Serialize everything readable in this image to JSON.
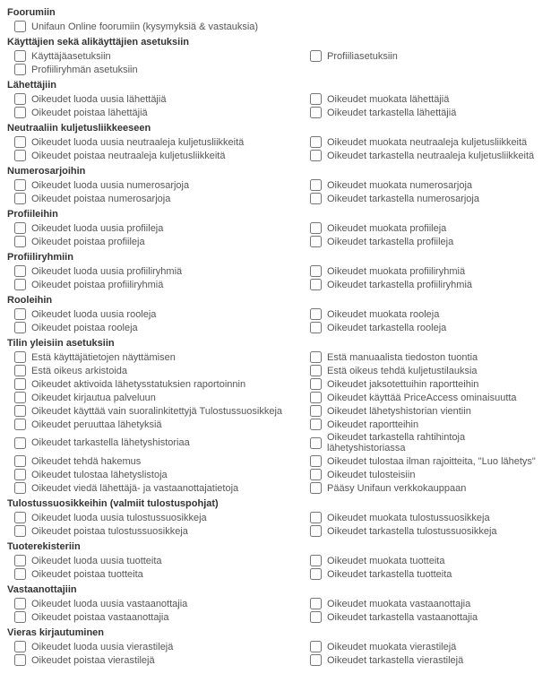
{
  "sections": [
    {
      "title": "Foorumiin",
      "items": [
        {
          "label": "Unifaun Online foorumiin (kysymyksiä & vastauksia)",
          "full": true
        }
      ]
    },
    {
      "title": "Käyttäjien sekä alikäyttäjien asetuksiin",
      "items": [
        {
          "label": "Käyttäjäasetuksiin"
        },
        {
          "label": "Profiiliasetuksiin"
        },
        {
          "label": "Profiiliryhmän asetuksiin",
          "full": true
        }
      ]
    },
    {
      "title": "Lähettäjiin",
      "items": [
        {
          "label": "Oikeudet luoda uusia lähettäjiä"
        },
        {
          "label": "Oikeudet muokata lähettäjiä"
        },
        {
          "label": "Oikeudet poistaa lähettäjiä"
        },
        {
          "label": "Oikeudet tarkastella lähettäjiä"
        }
      ]
    },
    {
      "title": "Neutraaliin kuljetusliikkeeseen",
      "items": [
        {
          "label": "Oikeudet luoda uusia neutraaleja kuljetusliikkeitä"
        },
        {
          "label": "Oikeudet muokata neutraaleja kuljetusliikkeitä"
        },
        {
          "label": "Oikeudet poistaa neutraaleja kuljetusliikkeitä"
        },
        {
          "label": "Oikeudet tarkastella neutraaleja kuljetusliikkeitä"
        }
      ]
    },
    {
      "title": "Numerosarjoihin",
      "items": [
        {
          "label": "Oikeudet luoda uusia numerosarjoja"
        },
        {
          "label": "Oikeudet muokata numerosarjoja"
        },
        {
          "label": "Oikeudet poistaa numerosarjoja"
        },
        {
          "label": "Oikeudet tarkastella numerosarjoja"
        }
      ]
    },
    {
      "title": "Profiileihin",
      "items": [
        {
          "label": "Oikeudet luoda uusia profiileja"
        },
        {
          "label": "Oikeudet muokata profiileja"
        },
        {
          "label": "Oikeudet poistaa profiileja"
        },
        {
          "label": "Oikeudet tarkastella profiileja"
        }
      ]
    },
    {
      "title": "Profiiliryhmiin",
      "items": [
        {
          "label": "Oikeudet luoda uusia profiiliryhmiä"
        },
        {
          "label": "Oikeudet muokata profiiliryhmiä"
        },
        {
          "label": "Oikeudet poistaa profiiliryhmiä"
        },
        {
          "label": "Oikeudet tarkastella profiiliryhmiä"
        }
      ]
    },
    {
      "title": "Rooleihin",
      "items": [
        {
          "label": "Oikeudet luoda uusia rooleja"
        },
        {
          "label": "Oikeudet muokata rooleja"
        },
        {
          "label": "Oikeudet poistaa rooleja"
        },
        {
          "label": "Oikeudet tarkastella rooleja"
        }
      ]
    },
    {
      "title": "Tilin yleisiin asetuksiin",
      "items": [
        {
          "label": "Estä käyttäjätietojen näyttämisen"
        },
        {
          "label": "Estä manuaalista tiedoston tuontia"
        },
        {
          "label": "Estä oikeus arkistoida"
        },
        {
          "label": "Estä oikeus tehdä kuljetustilauksia"
        },
        {
          "label": "Oikeudet aktivoida lähetysstatuksien raportoinnin"
        },
        {
          "label": "Oikeudet jaksotettuihin raportteihin"
        },
        {
          "label": "Oikeudet kirjautua palveluun"
        },
        {
          "label": "Oikeudet käyttää PriceAccess ominaisuutta"
        },
        {
          "label": "Oikeudet käyttää vain suoralinkitettyjä Tulostussuosikkeja"
        },
        {
          "label": "Oikeudet lähetyshistorian vientiin"
        },
        {
          "label": "Oikeudet peruuttaa lähetyksiä"
        },
        {
          "label": "Oikeudet raportteihin"
        },
        {
          "label": "Oikeudet tarkastella lähetyshistoriaa"
        },
        {
          "label": "Oikeudet tarkastella rahtihintoja lähetyshistoriassa"
        },
        {
          "label": "Oikeudet tehdä hakemus"
        },
        {
          "label": "Oikeudet tulostaa ilman rajoitteita, \"Luo lähetys\""
        },
        {
          "label": "Oikeudet tulostaa lähetyslistoja"
        },
        {
          "label": "Oikeudet tulosteisiin"
        },
        {
          "label": "Oikeudet viedä lähettäjä- ja vastaanottajatietoja"
        },
        {
          "label": "Pääsy Unifaun verkkokauppaan"
        }
      ]
    },
    {
      "title": "Tulostussuosikkeihin (valmiit tulostuspohjat)",
      "items": [
        {
          "label": "Oikeudet luoda uusia tulostussuosikkeja"
        },
        {
          "label": "Oikeudet muokata tulostussuosikkeja"
        },
        {
          "label": "Oikeudet poistaa tulostussuosikkeja"
        },
        {
          "label": "Oikeudet tarkastella tulostussuosikkeja"
        }
      ]
    },
    {
      "title": "Tuoterekisteriin",
      "items": [
        {
          "label": "Oikeudet luoda uusia tuotteita"
        },
        {
          "label": "Oikeudet muokata tuotteita"
        },
        {
          "label": "Oikeudet poistaa tuotteita"
        },
        {
          "label": "Oikeudet tarkastella tuotteita"
        }
      ]
    },
    {
      "title": "Vastaanottajiin",
      "items": [
        {
          "label": "Oikeudet luoda uusia vastaanottajia"
        },
        {
          "label": "Oikeudet muokata vastaanottajia"
        },
        {
          "label": "Oikeudet poistaa vastaanottajia"
        },
        {
          "label": "Oikeudet tarkastella vastaanottajia"
        }
      ]
    },
    {
      "title": "Vieras kirjautuminen",
      "items": [
        {
          "label": "Oikeudet luoda uusia vierastilejä"
        },
        {
          "label": "Oikeudet muokata vierastilejä"
        },
        {
          "label": "Oikeudet poistaa vierastilejä"
        },
        {
          "label": "Oikeudet tarkastella vierastilejä"
        }
      ]
    }
  ]
}
